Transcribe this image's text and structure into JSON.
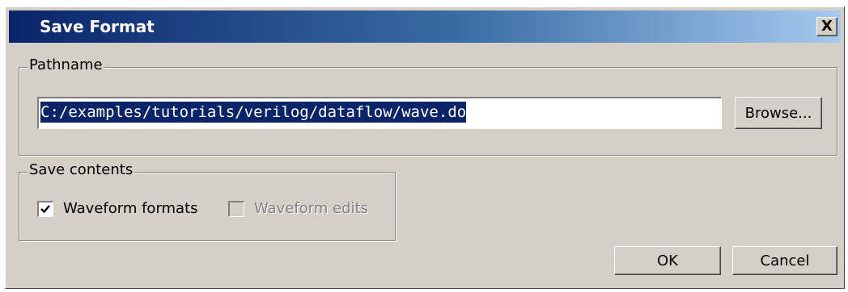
{
  "window": {
    "title": "Save Format",
    "close_label": "X"
  },
  "pathname_group": {
    "label": "Pathname",
    "path_value": "C:/examples/tutorials/verilog/dataflow/wave.do",
    "browse_label": "Browse..."
  },
  "save_contents_group": {
    "label": "Save contents",
    "options": [
      {
        "label": "Waveform formats",
        "checked": true,
        "enabled": true
      },
      {
        "label": "Waveform edits",
        "checked": false,
        "enabled": false
      }
    ]
  },
  "buttons": {
    "ok_label": "OK",
    "cancel_label": "Cancel"
  },
  "colors": {
    "title_gradient_start": "#0a246a",
    "title_gradient_end": "#a6caf0",
    "dialog_face": "#d4d0c8",
    "selection": "#0a246a"
  },
  "icons": {
    "close": "close-icon",
    "check": "checkmark-icon"
  }
}
